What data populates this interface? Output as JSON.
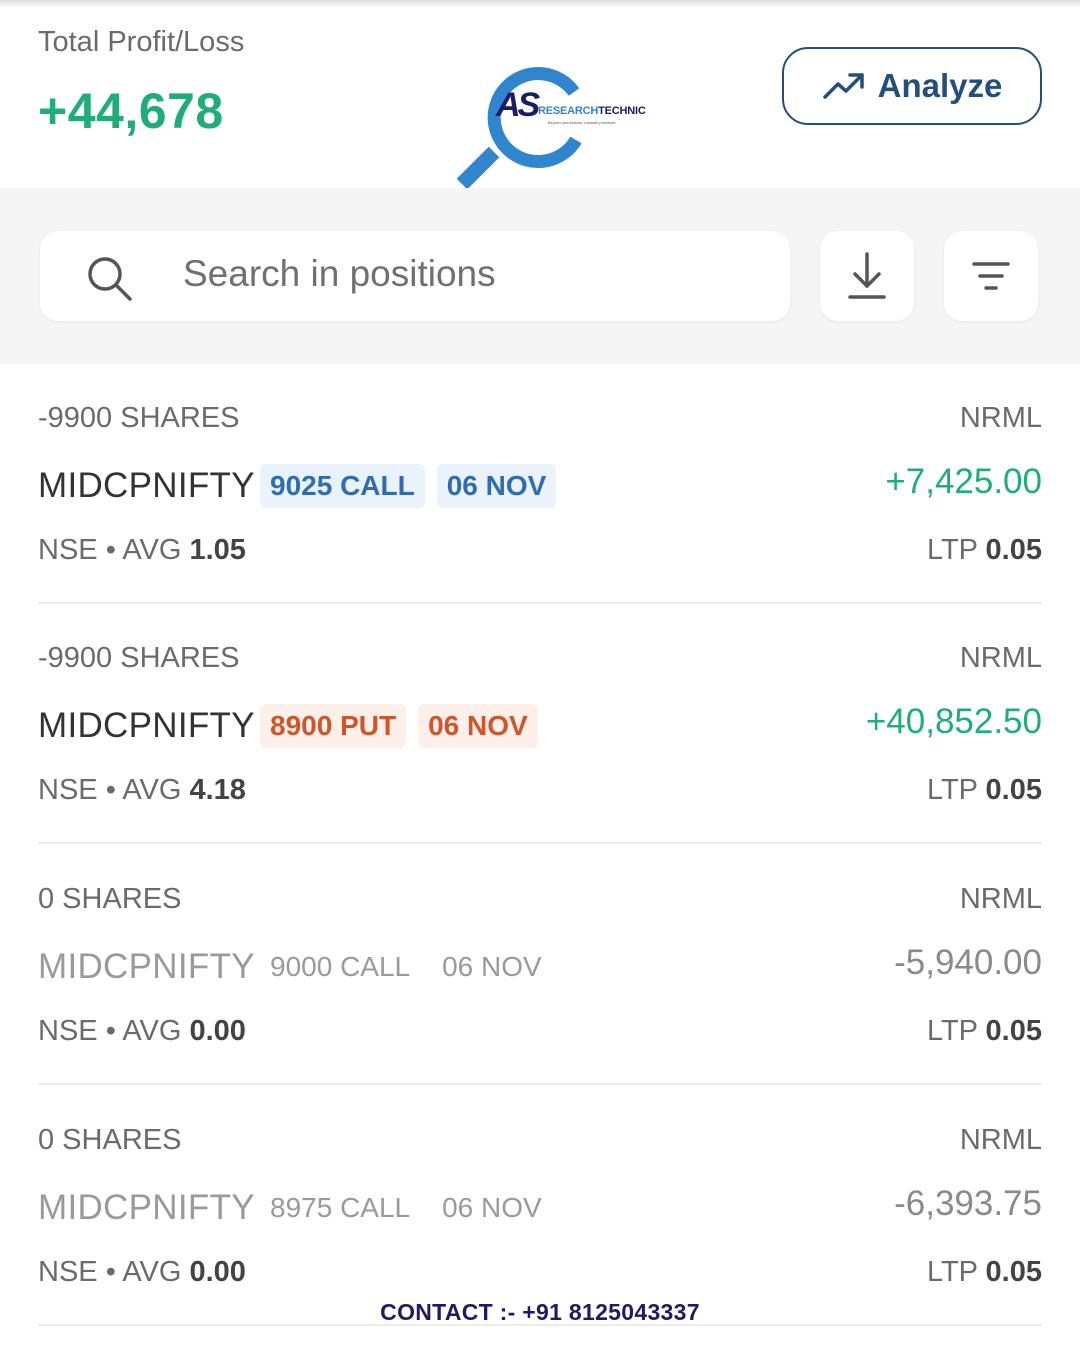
{
  "header": {
    "pl_label": "Total Profit/Loss",
    "pl_value": "+44,678",
    "analyze_label": "Analyze"
  },
  "logo": {
    "mark": "AS",
    "name_a": "RESEARCH",
    "name_b": "TECHNIC",
    "tagline": "Beyond predictions, towards precision."
  },
  "search": {
    "placeholder": "Search in positions"
  },
  "positions": [
    {
      "shares": "-9900 SHARES",
      "product": "NRML",
      "symbol": "MIDCPNIFTY",
      "strike": "9025 CALL",
      "expiry": "06 NOV",
      "pnl": "+7,425.00",
      "exchange": "NSE",
      "avg_label": "AVG",
      "avg": "1.05",
      "ltp_label": "LTP",
      "ltp": "0.05"
    },
    {
      "shares": "-9900 SHARES",
      "product": "NRML",
      "symbol": "MIDCPNIFTY",
      "strike": "8900 PUT",
      "expiry": "06 NOV",
      "pnl": "+40,852.50",
      "exchange": "NSE",
      "avg_label": "AVG",
      "avg": "4.18",
      "ltp_label": "LTP",
      "ltp": "0.05"
    },
    {
      "shares": "0 SHARES",
      "product": "NRML",
      "symbol": "MIDCPNIFTY",
      "strike": "9000 CALL",
      "expiry": "06 NOV",
      "pnl": "-5,940.00",
      "exchange": "NSE",
      "avg_label": "AVG",
      "avg": "0.00",
      "ltp_label": "LTP",
      "ltp": "0.05"
    },
    {
      "shares": "0 SHARES",
      "product": "NRML",
      "symbol": "MIDCPNIFTY",
      "strike": "8975 CALL",
      "expiry": "06 NOV",
      "pnl": "-6,393.75",
      "exchange": "NSE",
      "avg_label": "AVG",
      "avg": "0.00",
      "ltp_label": "LTP",
      "ltp": "0.05"
    }
  ],
  "footer": {
    "contact": "CONTACT :- +91 8125043337"
  },
  "colors": {
    "profit": "#1fae7a",
    "call": "#2f6db2",
    "put": "#d1552a",
    "brand": "#234f7a"
  },
  "icons": {
    "analyze": "trending-up-icon",
    "search": "search-icon",
    "download": "download-icon",
    "filter": "filter-icon"
  }
}
